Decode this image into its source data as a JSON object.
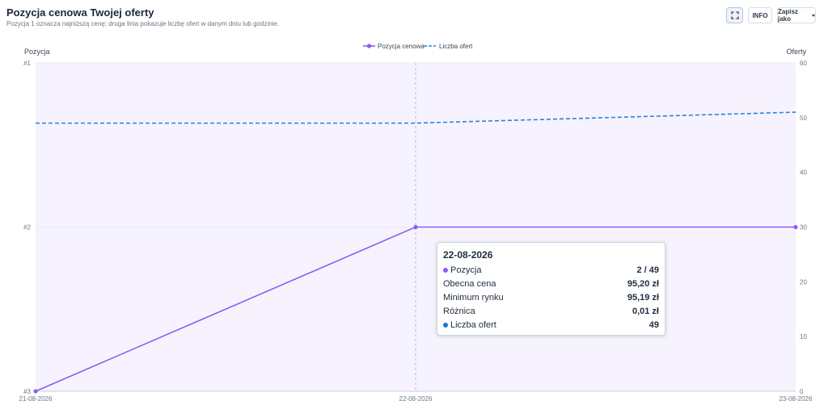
{
  "header": {
    "title": "Pozycja cenowa Twojej oferty",
    "subtitle": "Pozycja 1 oznacza najniższą cenę; druga linia pokazuje liczbę ofert w danym dniu lub godzinie."
  },
  "toolbar": {
    "expand_icon": "expand-icon",
    "info_label": "INFO",
    "save_label": "Zapisz jako"
  },
  "colors": {
    "position": "#8b5cf6",
    "offers": "#2f80d6",
    "plot_band": "#f6f3fe"
  },
  "chart_data": {
    "type": "line",
    "x": [
      "21-08-2026",
      "22-08-2026",
      "23-08-2026"
    ],
    "legend_position": "top-center",
    "y_left": {
      "label": "Pozycja",
      "ticks": [
        "#1",
        "#2",
        "#3"
      ],
      "range": [
        1,
        3
      ],
      "reversed": true
    },
    "y_right": {
      "label": "Oferty",
      "ticks": [
        0,
        10,
        20,
        30,
        40,
        50,
        60
      ],
      "range": [
        0,
        60
      ]
    },
    "series": [
      {
        "name": "Pozycja cenowa",
        "axis": "left",
        "style": "solid",
        "markers": true,
        "values": [
          3,
          2,
          2
        ]
      },
      {
        "name": "Liczba ofert",
        "axis": "right",
        "style": "dashed",
        "markers": false,
        "values": [
          49,
          49,
          51
        ]
      }
    ],
    "crosshair_x": "22-08-2026"
  },
  "tooltip": {
    "date": "22-08-2026",
    "rows": [
      {
        "label": "Pozycja",
        "value": "2 / 49",
        "marker": "position"
      },
      {
        "label": "Obecna cena",
        "value": "95,20 zł"
      },
      {
        "label": "Minimum rynku",
        "value": "95,19 zł"
      },
      {
        "label": "Różnica",
        "value": "0,01 zł"
      },
      {
        "label": "Liczba ofert",
        "value": "49",
        "marker": "offers"
      }
    ]
  }
}
